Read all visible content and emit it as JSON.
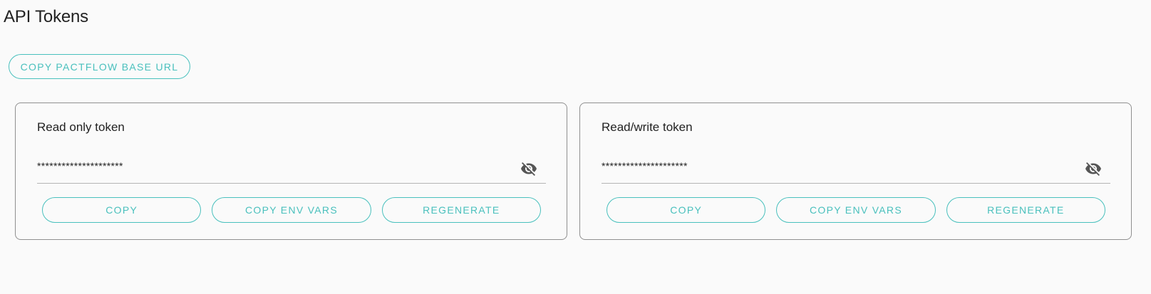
{
  "page": {
    "title": "API Tokens"
  },
  "toolbar": {
    "copy_base_url_label": "COPY PACTFLOW BASE URL"
  },
  "tokens": [
    {
      "title": "Read only token",
      "masked_value": "*********************",
      "visibility_icon": "eye-off-icon",
      "buttons": {
        "copy": "COPY",
        "copy_env_vars": "COPY ENV VARS",
        "regenerate": "REGENERATE"
      }
    },
    {
      "title": "Read/write token",
      "masked_value": "*********************",
      "visibility_icon": "eye-off-icon",
      "buttons": {
        "copy": "COPY",
        "copy_env_vars": "COPY ENV VARS",
        "regenerate": "REGENERATE"
      }
    }
  ],
  "colors": {
    "accent": "#49c0bd",
    "background": "#fafafa",
    "card_border": "#8f8f8f",
    "icon": "#555555"
  }
}
